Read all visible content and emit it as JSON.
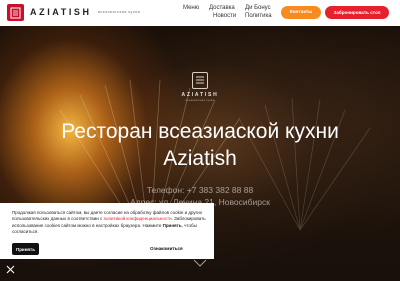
{
  "header": {
    "logo_text": "AZIATISH",
    "logo_subtitle": "всеазиатская кухня",
    "nav": [
      {
        "label": "Меню"
      },
      {
        "label": "Доставка"
      },
      {
        "label": "Новости"
      },
      {
        "label": "Ди Бонус"
      },
      {
        "label": "Политика"
      }
    ],
    "contacts_button": "Контакты",
    "book_button": "Забронировать стол"
  },
  "hero": {
    "logo_word": "AZIATISH",
    "logo_subtitle": "всеазиатская кухня",
    "title_line1": "Ресторан всеазиаской кухни",
    "title_line2": "Aziatish",
    "phone": "Телефон: +7 383 382 88 88",
    "address": "Адрес: ул. Ленина 21, Новосибирск"
  },
  "cookie": {
    "text_before_link": "Продолжая пользоваться сайтом, вы даете согласие на обработку файлов cookie и других пользовательских данных в соответствии с ",
    "link_text": "политикой конфиденциальности",
    "text_after_link": ". Заблокировать использование cookies сайтом можно в настройках браузера. Нажмите ",
    "accept_word": "Принять",
    "text_end": ", чтобы согласиться.",
    "accept_button": "Принять",
    "more_button": "Ознакомиться"
  },
  "colors": {
    "brand_red": "#c8102e",
    "contacts_orange": "#f68b1f",
    "book_red": "#e5212d"
  }
}
